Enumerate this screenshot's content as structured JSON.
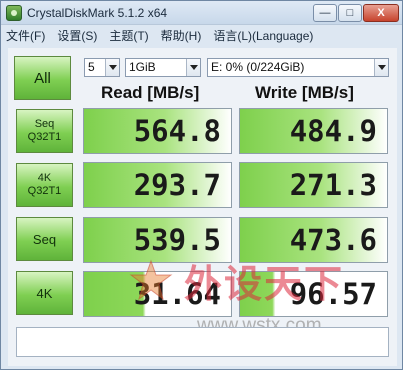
{
  "window": {
    "title": "CrystalDiskMark 5.1.2 x64",
    "controls": {
      "minimize": "—",
      "maximize": "□",
      "close": "X"
    }
  },
  "menu": [
    "文件(F)",
    "设置(S)",
    "主题(T)",
    "帮助(H)",
    "语言(L)(Language)"
  ],
  "toolbar": {
    "all_label": "All",
    "count_value": "5",
    "size_value": "1GiB",
    "drive_value": "E: 0% (0/224GiB)"
  },
  "columns": {
    "read": "Read [MB/s]",
    "write": "Write [MB/s]"
  },
  "rows": [
    {
      "label1": "Seq",
      "label2": "Q32T1",
      "read": "564.8",
      "write": "484.9",
      "read_fill_pct": 100,
      "write_fill_pct": 100
    },
    {
      "label1": "4K",
      "label2": "Q32T1",
      "read": "293.7",
      "write": "271.3",
      "read_fill_pct": 100,
      "write_fill_pct": 100
    },
    {
      "label1": "Seq",
      "label2": "",
      "read": "539.5",
      "write": "473.6",
      "read_fill_pct": 100,
      "write_fill_pct": 100
    },
    {
      "label1": "4K",
      "label2": "",
      "read": "31.64",
      "write": "96.57",
      "read_fill_pct": 42,
      "write_fill_pct": 24
    }
  ],
  "comment_value": "",
  "watermark": {
    "text": "外设天下",
    "url": "www.wstx.com"
  },
  "colors": {
    "accent_green": "#7ed04c",
    "button_green": "#7fcf52",
    "watermark_red": "#dc283c"
  }
}
